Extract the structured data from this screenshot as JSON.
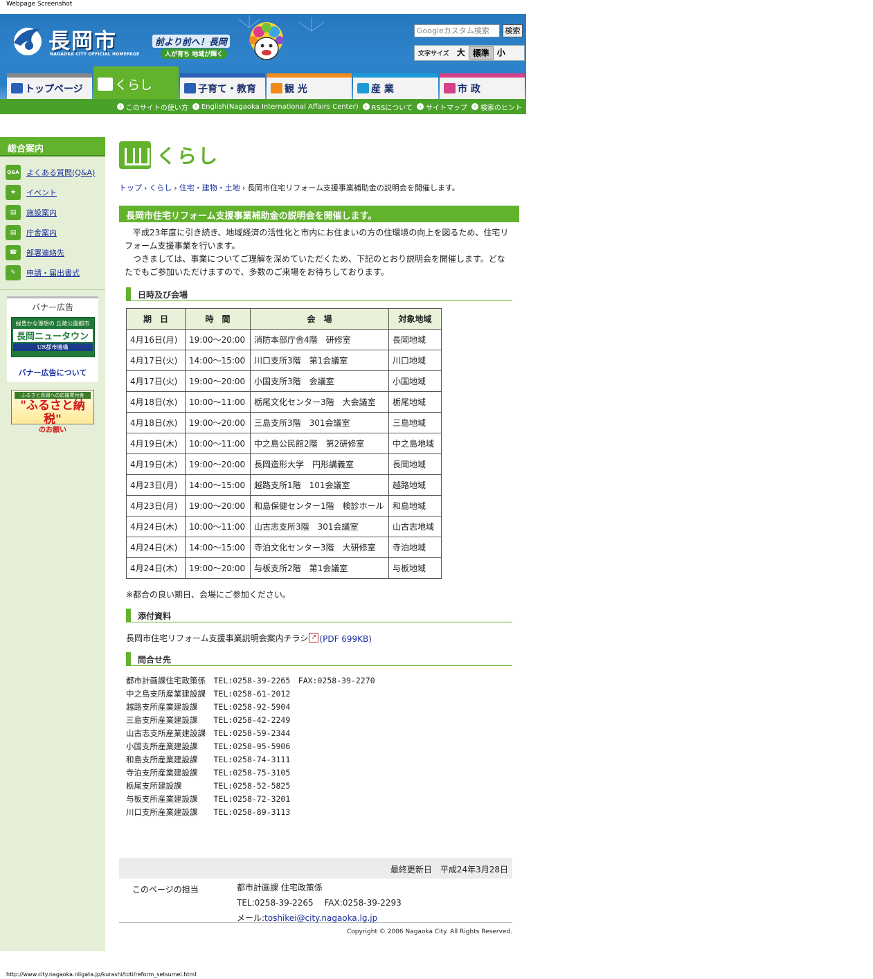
{
  "caption": "Webpage Screenshot",
  "status_url": "http://www.city.nagaoka.niigata.jp/kurashi/toti/reform_setsumei.html",
  "colors": {
    "green": "#62b22c",
    "blue": "#2a7ec6",
    "link": "#1a2ea0"
  },
  "header": {
    "logo_name": "長岡市",
    "logo_sub": "NAGAOKA CITY OFFICIAL HOMEPAGE",
    "slogan_main": "前より前へ！長岡",
    "slogan_sub": "人が育ち 地域が輝く",
    "search_placeholder": "Googleカスタム検索",
    "search_button": "検索",
    "fontsize_label": "文字サイズ",
    "fontsize": {
      "large": "大",
      "normal": "標準",
      "small": "小"
    }
  },
  "tabs": [
    {
      "label": "トップページ",
      "color": "#7a7a7a"
    },
    {
      "label": "くらし",
      "color": "#62b22c"
    },
    {
      "label": "子育て・教育",
      "color": "#2a5fb8"
    },
    {
      "label": "観 光",
      "color": "#f08a1a"
    },
    {
      "label": "産 業",
      "color": "#1d9ad6"
    },
    {
      "label": "市 政",
      "color": "#d6418a"
    }
  ],
  "util_links": [
    "このサイトの使い方",
    "English(Nagaoka International Affairs Center)",
    "RSSについて",
    "サイトマップ",
    "検索のヒント"
  ],
  "sidebar": {
    "heading": "総合案内",
    "items": [
      {
        "label": "よくある質問(Q&A)",
        "icon": "Q&A"
      },
      {
        "label": "イベント",
        "icon": "ev"
      },
      {
        "label": "施設案内",
        "icon": "bldg"
      },
      {
        "label": "庁舎案内",
        "icon": "bldg"
      },
      {
        "label": "部署連絡先",
        "icon": "tel"
      },
      {
        "label": "申請・届出書式",
        "icon": "doc"
      }
    ],
    "banner_title": "バナー広告",
    "banner": {
      "line1": "緑豊かな理想の 丘陵公園都市",
      "line2": "長岡ニュータウン",
      "line3": "UR都市機構"
    },
    "banner_link": "バナー広告について",
    "furusato": {
      "line1": "ふるさと長岡への応援寄付金",
      "line2": "\"ふるさと納税\"",
      "line3": "のお願い"
    }
  },
  "main": {
    "category": "くらし",
    "breadcrumb": [
      "トップ",
      "くらし",
      "住宅・建物・土地"
    ],
    "breadcrumb_current": "長岡市住宅リフォーム支援事業補助金の説明会を開催します。",
    "title": "長岡市住宅リフォーム支援事業補助金の説明会を開催します。",
    "intro_1": "　平成23年度に引き続き、地域経済の活性化と市内にお住まいの方の住環境の向上を図るため、住宅リフォーム支援事業を行います。",
    "intro_2": "　つきましては、事業についてご理解を深めていただくため、下記のとおり説明会を開催します。どなたでもご参加いただけますので、多数のご来場をお待ちしております。",
    "section_schedule": "日時及び会場",
    "table_headers": [
      "期　日",
      "時　間",
      "会　場",
      "対象地域"
    ],
    "table_rows": [
      [
        "4月16日(月)",
        "19:00～20:00",
        "消防本部庁舎4階　研修室",
        "長岡地域"
      ],
      [
        "4月17日(火)",
        "14:00～15:00",
        "川口支所3階　第1会議室",
        "川口地域"
      ],
      [
        "4月17日(火)",
        "19:00～20:00",
        "小国支所3階　会議室",
        "小国地域"
      ],
      [
        "4月18日(水)",
        "10:00～11:00",
        "栃尾文化センター3階　大会議室",
        "栃尾地域"
      ],
      [
        "4月18日(水)",
        "19:00～20:00",
        "三島支所3階　301会議室",
        "三島地域"
      ],
      [
        "4月19日(木)",
        "10:00～11:00",
        "中之島公民館2階　第2研修室",
        "中之島地域"
      ],
      [
        "4月19日(木)",
        "19:00～20:00",
        "長岡造形大学　円形講義室",
        "長岡地域"
      ],
      [
        "4月23日(月)",
        "14:00～15:00",
        "越路支所1階　101会議室",
        "越路地域"
      ],
      [
        "4月23日(月)",
        "19:00～20:00",
        "和島保健センター1階　検診ホール",
        "和島地域"
      ],
      [
        "4月24日(木)",
        "10:00～11:00",
        "山古志支所3階　301会議室",
        "山古志地域"
      ],
      [
        "4月24日(木)",
        "14:00～15:00",
        "寺泊文化センター3階　大研修室",
        "寺泊地域"
      ],
      [
        "4月24日(木)",
        "19:00～20:00",
        "与板支所2階　第1会議室",
        "与板地域"
      ]
    ],
    "note": "※都合の良い期日、会場にご参加ください。",
    "section_attach": "添付資料",
    "attach_text": "長岡市住宅リフォーム支援事業説明会案内チラシ",
    "attach_link": "(PDF 699KB)",
    "section_contact": "問合せ先",
    "contacts": [
      "都市計画課住宅政策係　TEL:0258-39-2265　FAX:0258-39-2270",
      "中之島支所産業建設課　TEL:0258-61-2012",
      "越路支所産業建設課　　TEL:0258-92-5904",
      "三島支所産業建設課　　TEL:0258-42-2249",
      "山古志支所産業建設課　TEL:0258-59-2344",
      "小国支所産業建設課　　TEL:0258-95-5906",
      "和島支所産業建設課　　TEL:0258-74-3111",
      "寺泊支所産業建設課　　TEL:0258-75-3105",
      "栃尾支所建設課　　　　TEL:0258-52-5825",
      "与板支所産業建設課　　TEL:0258-72-3201",
      "川口支所産業建設課　　TEL:0258-89-3113"
    ],
    "updated": "最終更新日　平成24年3月28日",
    "owner_label": "このページの担当",
    "owner_dept": "都市計画課 住宅政策係",
    "owner_tel": "TEL:0258-39-2265　 FAX:0258-39-2293",
    "owner_mail_label": "メール:",
    "owner_mail": "toshikei@city.nagaoka.lg.jp",
    "copyright": "Copyright © 2006 Nagaoka City. All Rights Reserved."
  }
}
